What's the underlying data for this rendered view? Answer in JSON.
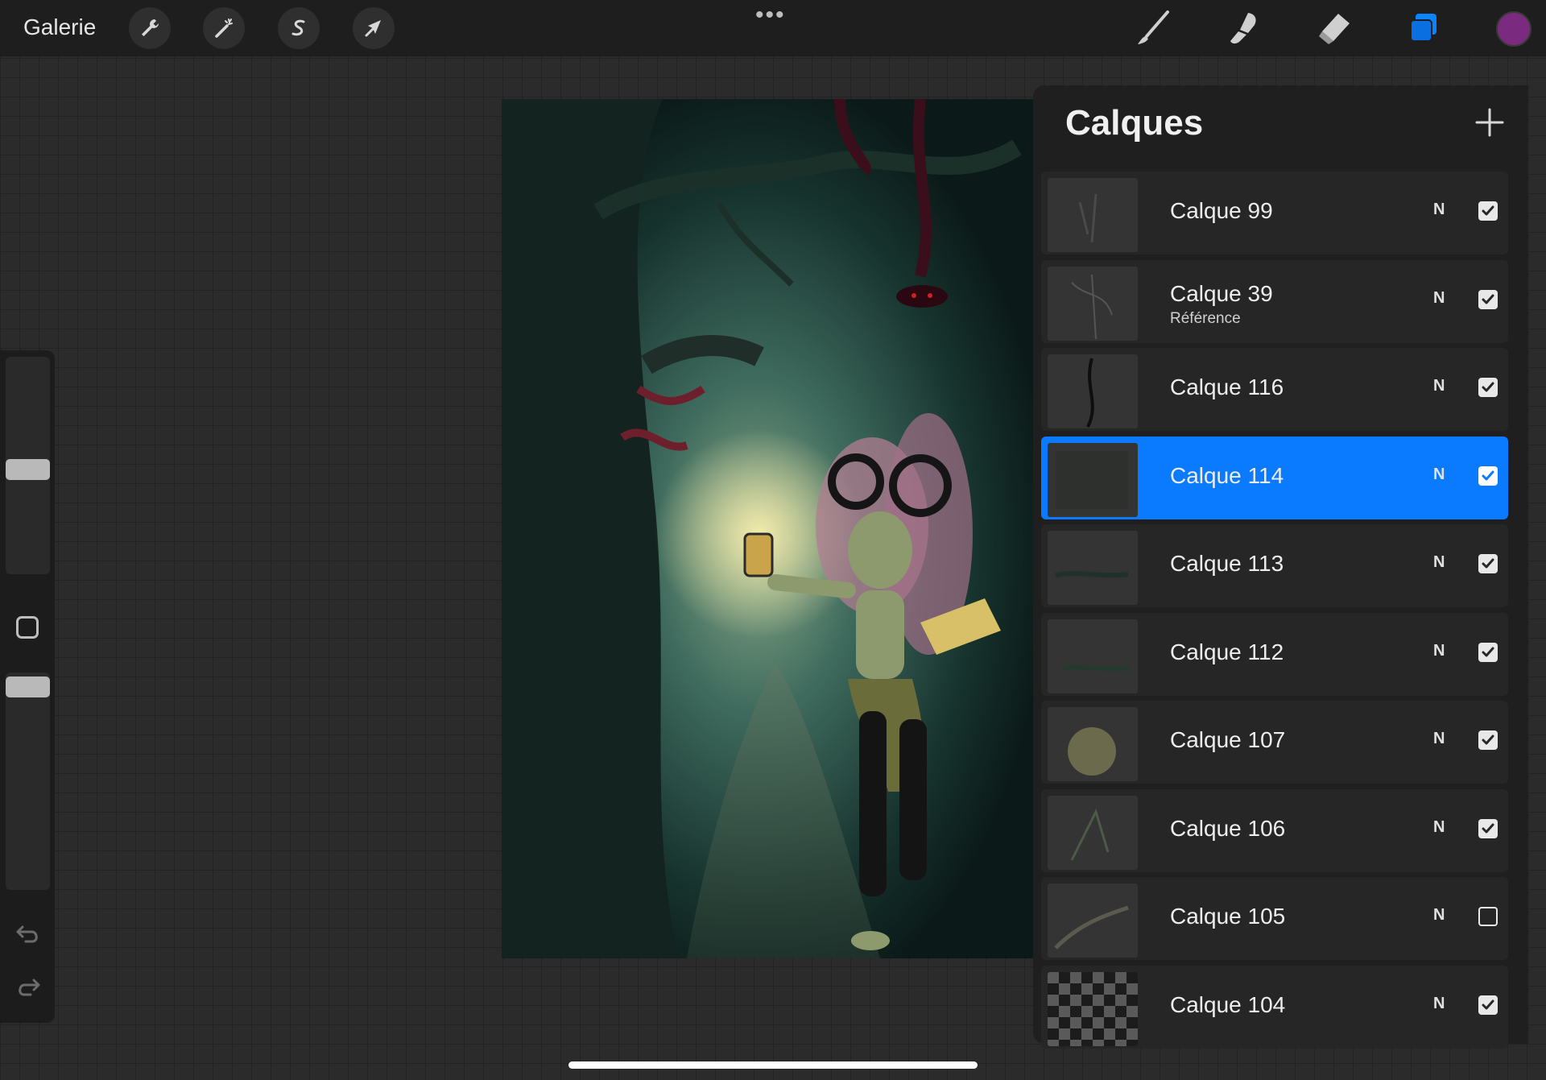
{
  "topbar": {
    "gallery_label": "Galerie",
    "tools_left": [
      "wrench-icon",
      "magic-wand-icon",
      "selection-s-icon",
      "transform-arrow-icon"
    ],
    "more_label": "•••",
    "tools_right": [
      "brush-icon",
      "smudge-icon",
      "eraser-icon",
      "layers-icon"
    ],
    "active_tool": "layers-icon",
    "active_color": "#7a2a7f"
  },
  "sidebar": {
    "brush_size": 0.48,
    "opacity": 0.98
  },
  "layers": {
    "title": "Calques",
    "add_icon": "plus-icon",
    "items": [
      {
        "name": "Calque 99",
        "sub": "",
        "blend": "N",
        "visible": true,
        "selected": false
      },
      {
        "name": "Calque 39",
        "sub": "Référence",
        "blend": "N",
        "visible": true,
        "selected": false
      },
      {
        "name": "Calque 116",
        "sub": "",
        "blend": "N",
        "visible": true,
        "selected": false
      },
      {
        "name": "Calque 114",
        "sub": "",
        "blend": "N",
        "visible": true,
        "selected": true
      },
      {
        "name": "Calque 113",
        "sub": "",
        "blend": "N",
        "visible": true,
        "selected": false
      },
      {
        "name": "Calque 112",
        "sub": "",
        "blend": "N",
        "visible": true,
        "selected": false
      },
      {
        "name": "Calque 107",
        "sub": "",
        "blend": "N",
        "visible": true,
        "selected": false
      },
      {
        "name": "Calque 106",
        "sub": "",
        "blend": "N",
        "visible": true,
        "selected": false
      },
      {
        "name": "Calque 105",
        "sub": "",
        "blend": "N",
        "visible": false,
        "selected": false
      },
      {
        "name": "Calque 104",
        "sub": "",
        "blend": "N",
        "visible": true,
        "selected": false
      }
    ]
  }
}
